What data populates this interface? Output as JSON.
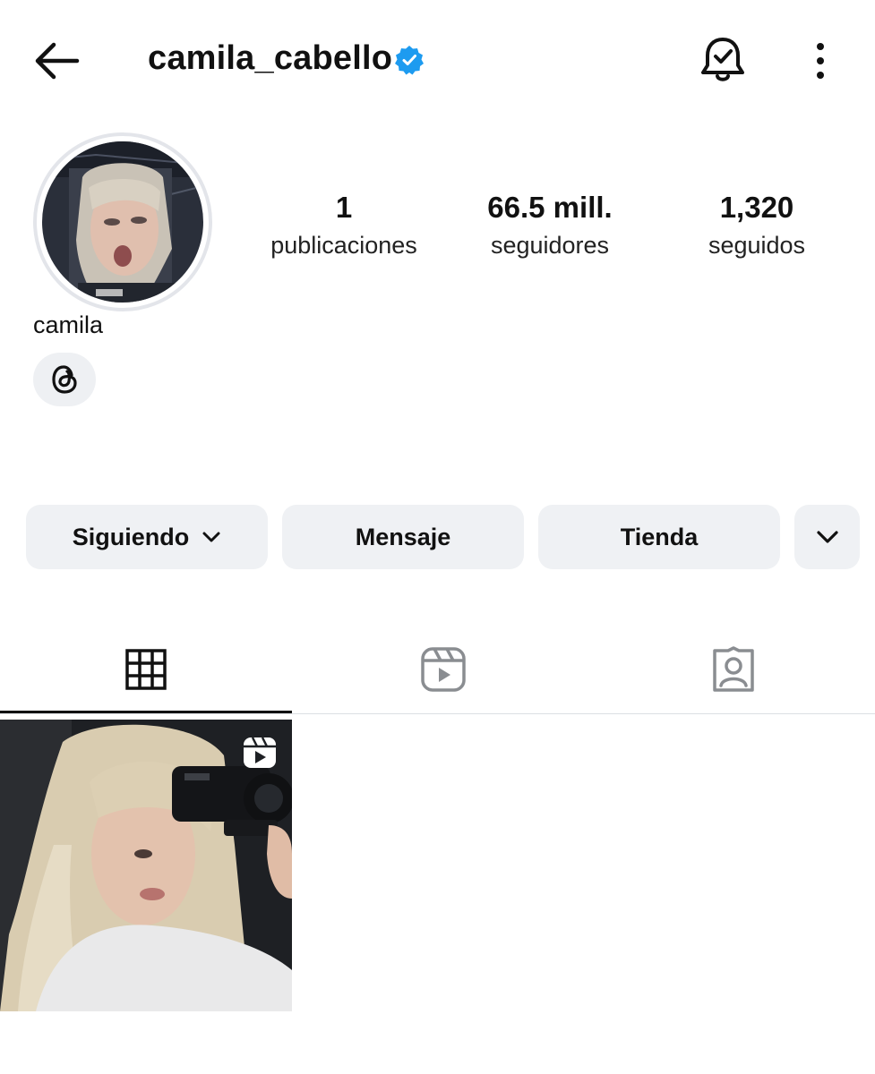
{
  "header": {
    "username": "camila_cabello",
    "verified": true,
    "icons": [
      "back-arrow-icon",
      "verified-badge-icon",
      "notification-bell-icon",
      "more-options-icon"
    ]
  },
  "profile": {
    "display_name": "camila",
    "stats": {
      "posts": {
        "value": "1",
        "label": "publicaciones"
      },
      "followers": {
        "value": "66.5 mill.",
        "label": "seguidores"
      },
      "following": {
        "value": "1,320",
        "label": "seguidos"
      }
    },
    "threads_icon": "threads-icon"
  },
  "actions": {
    "following_label": "Siguiendo",
    "message_label": "Mensaje",
    "shop_label": "Tienda"
  },
  "tabs": [
    {
      "icon": "grid-icon",
      "active": true
    },
    {
      "icon": "reels-icon",
      "active": false
    },
    {
      "icon": "tagged-icon",
      "active": false
    }
  ],
  "posts": [
    {
      "type": "reel",
      "icon": "reel-badge-icon"
    }
  ],
  "colors": {
    "verified_blue": "#1d9bf0",
    "button_bg": "#eff1f4",
    "text": "#111111",
    "inactive_icon": "#8a8d91"
  }
}
